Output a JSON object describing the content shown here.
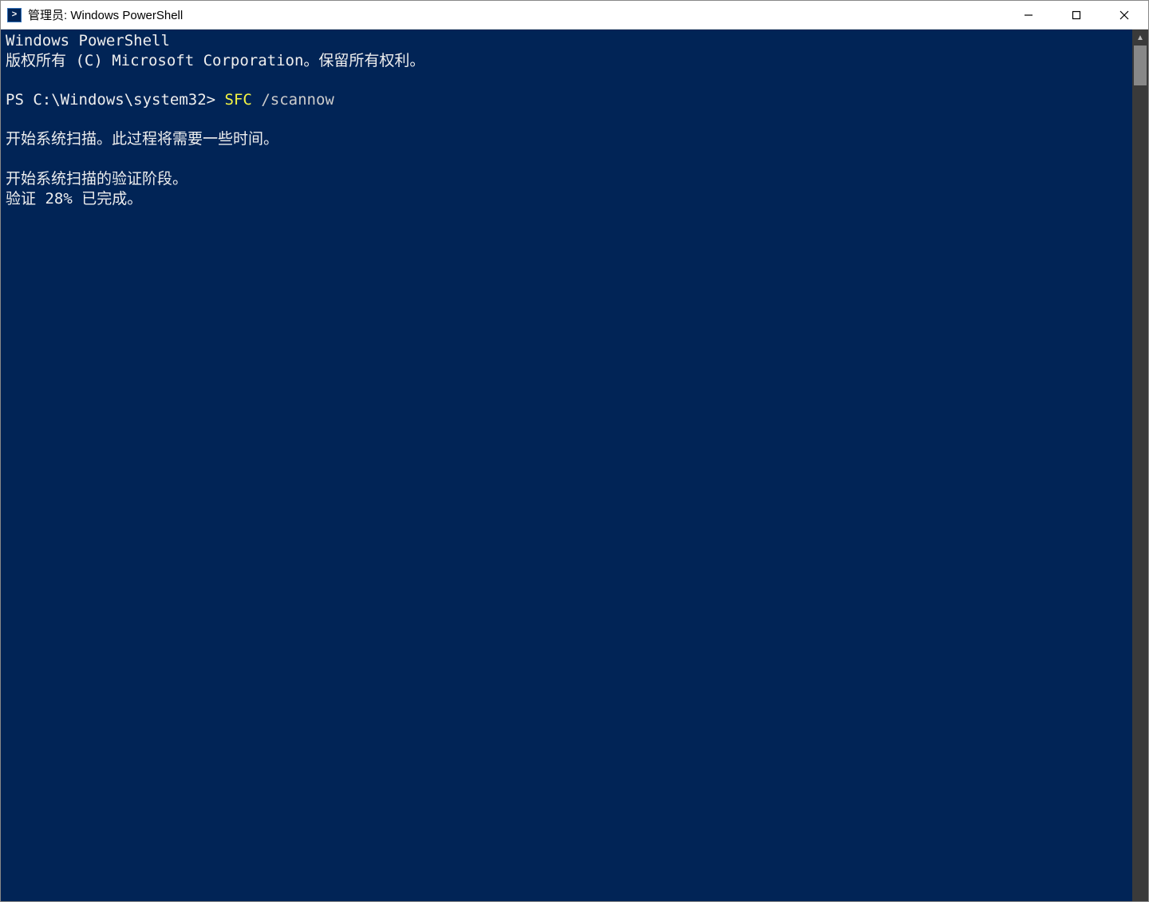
{
  "window": {
    "title": "管理员: Windows PowerShell"
  },
  "terminal": {
    "header_line1": "Windows PowerShell",
    "header_line2": "版权所有 (C) Microsoft Corporation。保留所有权利。",
    "prompt": "PS C:\\Windows\\system32> ",
    "command_name": "SFC",
    "command_args": " /scannow",
    "output_line1": "开始系统扫描。此过程将需要一些时间。",
    "output_line2": "开始系统扫描的验证阶段。",
    "output_line3": "验证 28% 已完成。"
  }
}
